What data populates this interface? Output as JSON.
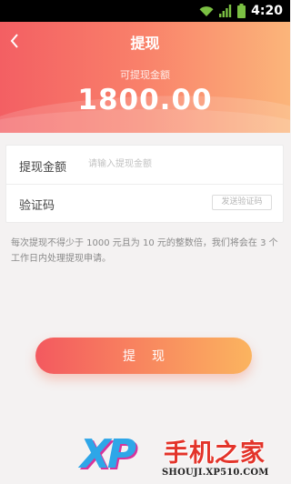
{
  "status_bar": {
    "time": "4:20",
    "icons": [
      "wifi-icon",
      "signal-icon",
      "battery-icon"
    ]
  },
  "nav": {
    "title": "提现",
    "back_icon": "chevron-left-icon"
  },
  "balance": {
    "label": "可提现金额",
    "amount": "1800.00"
  },
  "form": {
    "amount_label": "提现金额",
    "amount_placeholder": "请输入提现金额",
    "amount_value": "",
    "code_label": "验证码",
    "code_placeholder": "",
    "code_button": "发送验证码"
  },
  "notice": "每次提现不得少于 1000 元且为 10 元的整数倍，我们将会在 3 个工作日内处理提现申请。",
  "submit_label": "提现",
  "watermark": {
    "logo": "XP",
    "title": "手机之家",
    "url": "SHOUJI.XP510.COM"
  },
  "colors": {
    "hero_start": "#f35f63",
    "hero_end": "#fbb57a",
    "button_start": "#f3595f",
    "button_end": "#fbb45f",
    "background": "#f4f2f2"
  }
}
